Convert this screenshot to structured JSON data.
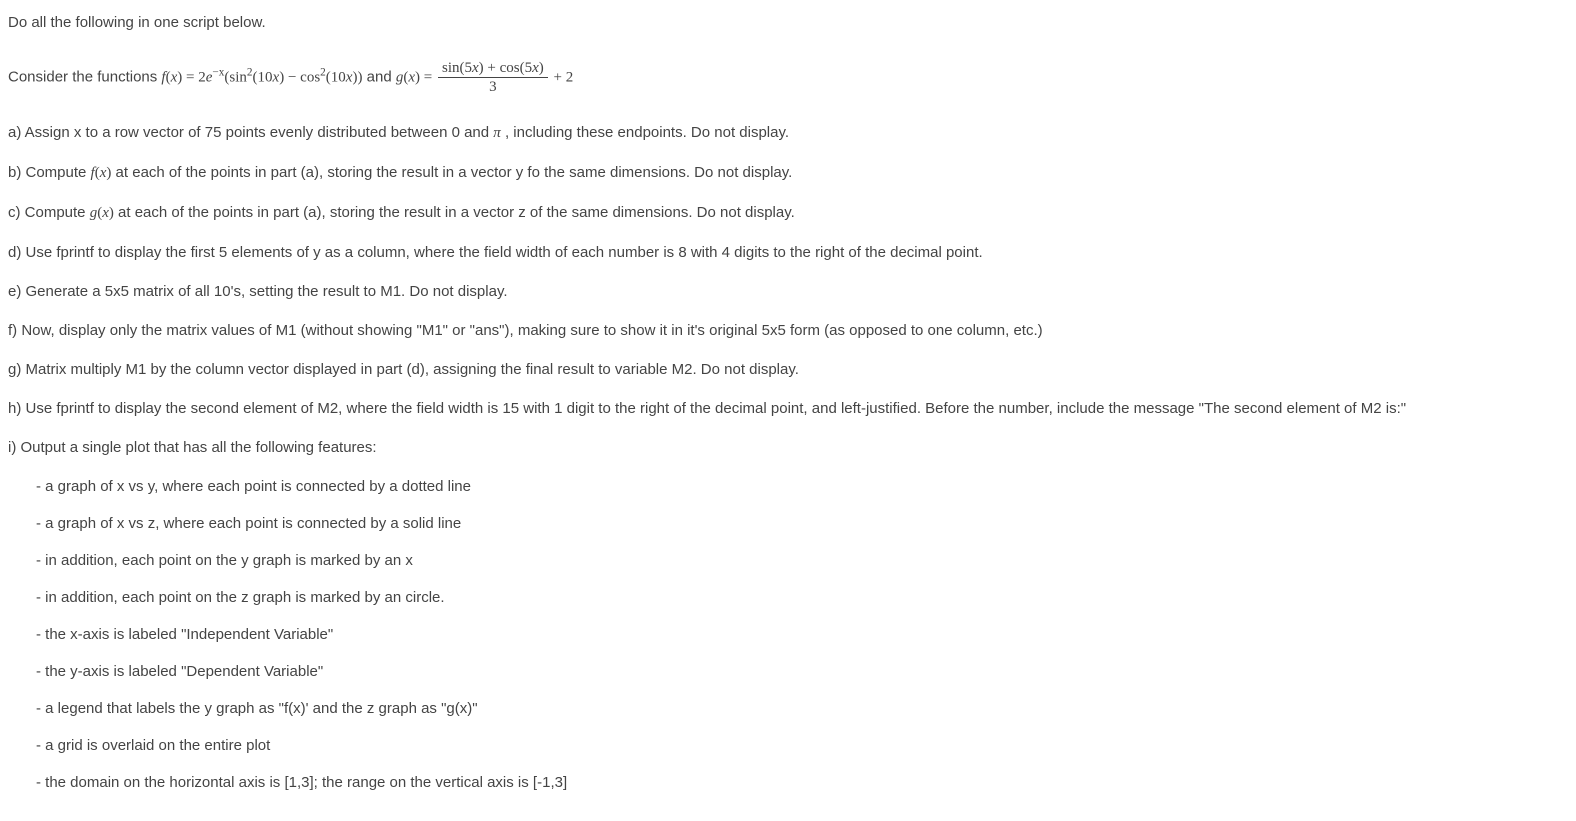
{
  "intro": "Do all the following in one script below.",
  "consider_prefix": "Consider the functions  ",
  "f_lhs": "f",
  "open_paren": "(",
  "x_var": "x",
  "close_paren": ")",
  "eq": " = ",
  "two": "2",
  "e_var": "e",
  "neg_x_sup": "−x",
  "sin_txt": "sin",
  "sq_sup": "2",
  "ten_x": "10x",
  "minus": " − ",
  "cos_txt": "cos",
  "and_txt": "  and  ",
  "g_lhs": "g",
  "frac_num_a": "sin",
  "frac_num_b": "(5",
  "frac_num_c": "x",
  "frac_num_d": ") + cos",
  "frac_num_e": "(5",
  "frac_num_f": "x",
  "frac_num_g": ")",
  "frac_den": "3",
  "plus2": " + 2",
  "a_prefix": "a) Assign x to a row vector of 75 points evenly distributed between 0 and ",
  "pi": "π",
  "a_suffix": " , including these endpoints. Do not display.",
  "b_prefix": "b) Compute  ",
  "b_suffix": "  at each of the points in part (a), storing the result in a vector y fo the same dimensions. Do not display.",
  "c_prefix": "c) Compute  ",
  "c_suffix": "  at each of the points in part (a), storing the result in a vector z of the same dimensions. Do not display.",
  "d": "d) Use fprintf to display the first 5 elements of y as a column, where the field width of each number is 8 with 4 digits to the right of the decimal point.",
  "e": "e) Generate a 5x5 matrix of all 10's, setting the result to M1. Do not display.",
  "f": "f) Now, display only the matrix values of M1 (without showing \"M1\" or \"ans\"), making sure to show it in it's original 5x5 form (as opposed to one column, etc.)",
  "g": "g) Matrix multiply M1 by the column vector displayed in part (d), assigning the final result to variable M2. Do not display.",
  "h": "h) Use fprintf to display the second element of M2, where the field width is 15 with 1 digit to the right of the decimal point, and left-justified. Before the number, include the message \"The second element of M2 is:\"",
  "i": "i) Output a single plot that has all the following features:",
  "sub": {
    "s1": "- a graph of x vs y, where each point is connected by a dotted line",
    "s2": "- a graph of x vs z, where each point is connected by a solid line",
    "s3": "- in addition, each point on the y graph is marked by an x",
    "s4": "- in addition, each point on the z graph is marked by an circle.",
    "s5": "- the x-axis is labeled \"Independent Variable\"",
    "s6": "- the y-axis is labeled \"Dependent Variable\"",
    "s7": "- a legend that labels the y graph as \"f(x)' and the z graph as \"g(x)\"",
    "s8": "- a grid is overlaid on the entire plot",
    "s9": "- the domain on the horizontal axis is [1,3]; the range on the vertical axis is [-1,3]"
  }
}
